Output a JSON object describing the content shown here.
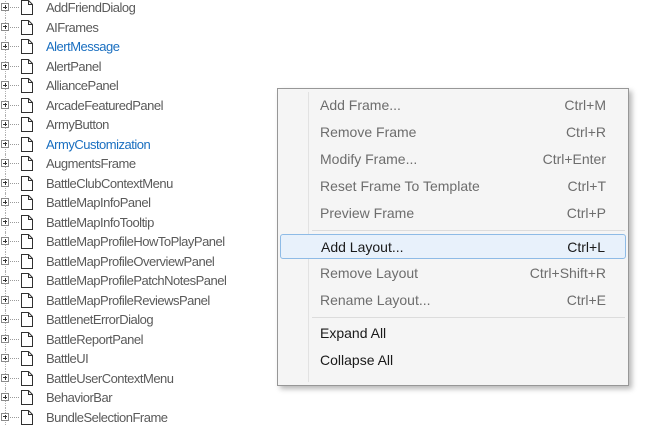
{
  "tree": {
    "items": [
      {
        "label": "AddFriendDialog",
        "link": false
      },
      {
        "label": "AIFrames",
        "link": false
      },
      {
        "label": "AlertMessage",
        "link": true
      },
      {
        "label": "AlertPanel",
        "link": false
      },
      {
        "label": "AlliancePanel",
        "link": false
      },
      {
        "label": "ArcadeFeaturedPanel",
        "link": false
      },
      {
        "label": "ArmyButton",
        "link": false
      },
      {
        "label": "ArmyCustomization",
        "link": true
      },
      {
        "label": "AugmentsFrame",
        "link": false
      },
      {
        "label": "BattleClubContextMenu",
        "link": false
      },
      {
        "label": "BattleMapInfoPanel",
        "link": false
      },
      {
        "label": "BattleMapInfoTooltip",
        "link": false
      },
      {
        "label": "BattleMapProfileHowToPlayPanel",
        "link": false
      },
      {
        "label": "BattleMapProfileOverviewPanel",
        "link": false
      },
      {
        "label": "BattleMapProfilePatchNotesPanel",
        "link": false
      },
      {
        "label": "BattleMapProfileReviewsPanel",
        "link": false
      },
      {
        "label": "BattlenetErrorDialog",
        "link": false
      },
      {
        "label": "BattleReportPanel",
        "link": false
      },
      {
        "label": "BattleUI",
        "link": false
      },
      {
        "label": "BattleUserContextMenu",
        "link": false
      },
      {
        "label": "BehaviorBar",
        "link": false
      },
      {
        "label": "BundleSelectionFrame",
        "link": false
      }
    ]
  },
  "context_menu": {
    "groups": [
      [
        {
          "label": "Add Frame...",
          "shortcut": "Ctrl+M",
          "enabled": false,
          "highlighted": false
        },
        {
          "label": "Remove Frame",
          "shortcut": "Ctrl+R",
          "enabled": false,
          "highlighted": false
        },
        {
          "label": "Modify Frame...",
          "shortcut": "Ctrl+Enter",
          "enabled": false,
          "highlighted": false
        },
        {
          "label": "Reset Frame To Template",
          "shortcut": "Ctrl+T",
          "enabled": false,
          "highlighted": false
        },
        {
          "label": "Preview Frame",
          "shortcut": "Ctrl+P",
          "enabled": false,
          "highlighted": false
        }
      ],
      [
        {
          "label": "Add Layout...",
          "shortcut": "Ctrl+L",
          "enabled": true,
          "highlighted": true
        },
        {
          "label": "Remove Layout",
          "shortcut": "Ctrl+Shift+R",
          "enabled": false,
          "highlighted": false
        },
        {
          "label": "Rename Layout...",
          "shortcut": "Ctrl+E",
          "enabled": false,
          "highlighted": false
        }
      ],
      [
        {
          "label": "Expand All",
          "shortcut": "",
          "enabled": true,
          "highlighted": false
        },
        {
          "label": "Collapse All",
          "shortcut": "",
          "enabled": true,
          "highlighted": false
        }
      ]
    ]
  },
  "icons": {
    "expander": "plus-box-icon",
    "node": "document-icon"
  },
  "colors": {
    "link_text": "#1a6fc0",
    "normal_text": "#5a5a5a",
    "menu_highlight_bg": "#e8f1fb",
    "menu_highlight_border": "#8ebbe6"
  }
}
